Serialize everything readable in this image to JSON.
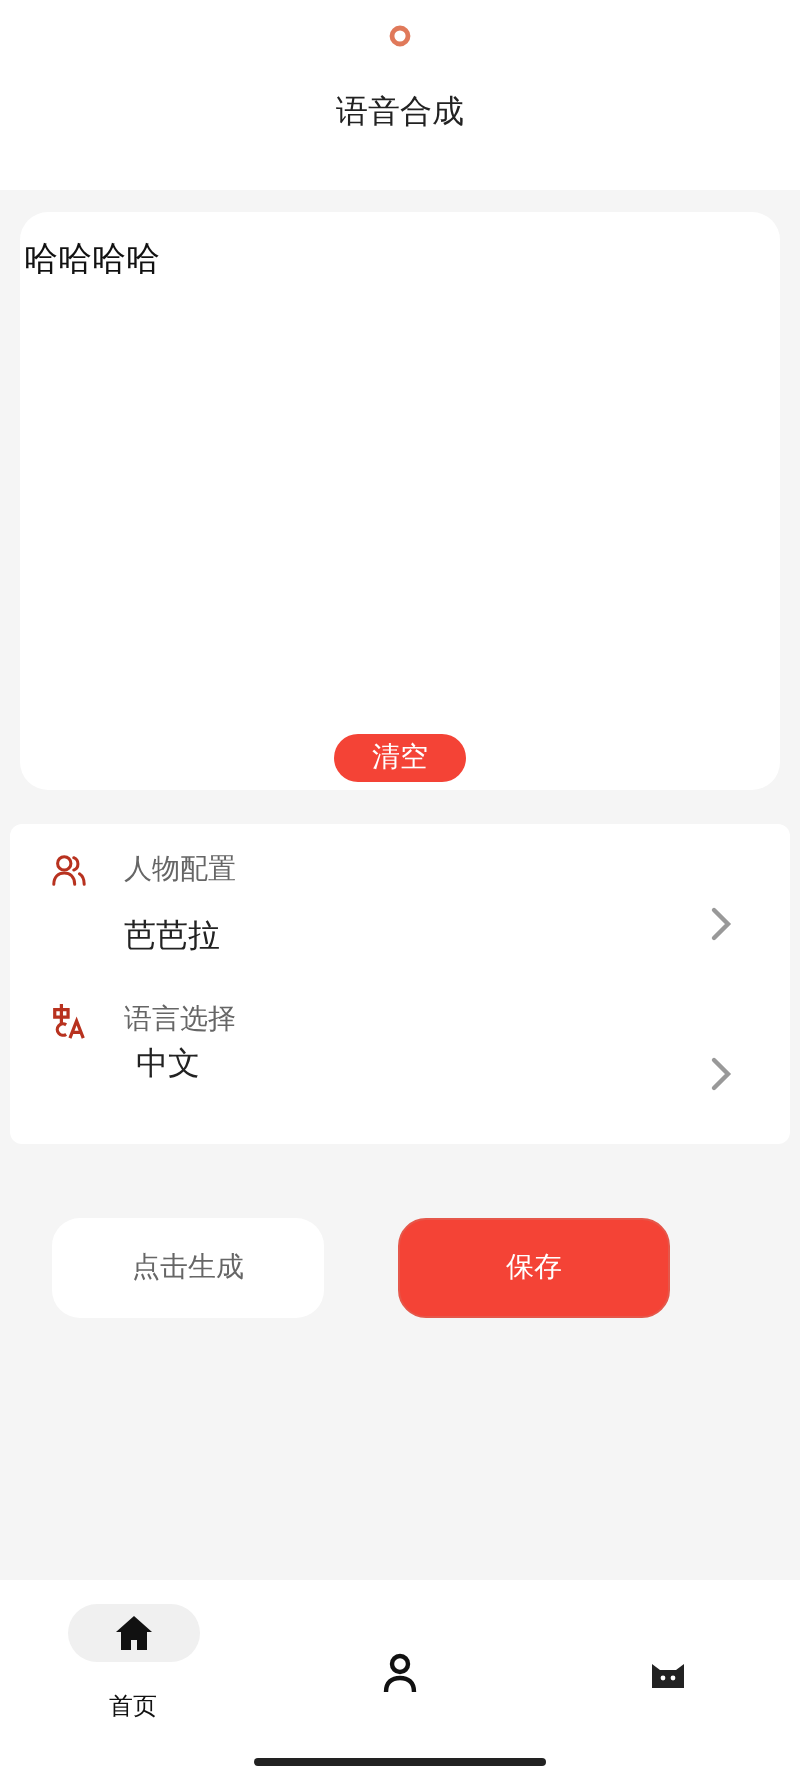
{
  "header": {
    "title": "语音合成"
  },
  "editor": {
    "value": "哈哈哈哈",
    "clear_button": "清空"
  },
  "settings": [
    {
      "kind": "person",
      "label": "人物配置",
      "value": "芭芭拉"
    },
    {
      "kind": "language",
      "label": "语言选择",
      "value": "中文"
    }
  ],
  "actions": [
    {
      "kind": "secondary",
      "label": "点击生成"
    },
    {
      "kind": "primary",
      "label": "保存"
    }
  ],
  "tabs": [
    {
      "kind": "home",
      "label": "首页",
      "selected": true
    },
    {
      "kind": "person",
      "selected": false
    },
    {
      "kind": "cat",
      "selected": false
    }
  ]
}
